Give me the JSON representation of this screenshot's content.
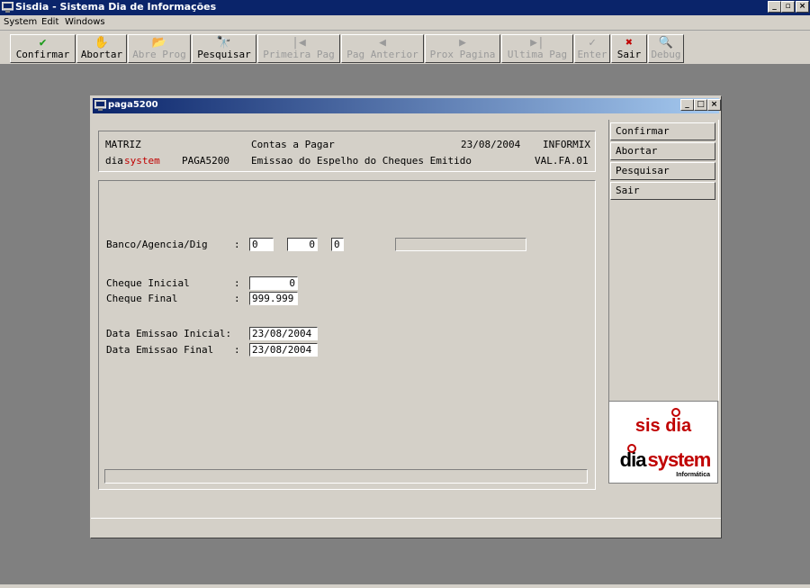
{
  "window": {
    "title": "Sisdia - Sistema Dia de Informações",
    "min": "_",
    "max": "▫",
    "close": "×"
  },
  "menu": [
    "System",
    "Edit",
    "Windows"
  ],
  "toolbar": [
    {
      "label": "Confirmar",
      "icon": "✔",
      "icon_name": "checkmark-icon",
      "enabled": true
    },
    {
      "label": "Abortar",
      "icon": "✋",
      "icon_name": "hand-icon",
      "enabled": true
    },
    {
      "label": "Abre Prog",
      "icon": "📂",
      "icon_name": "folder-icon",
      "enabled": false
    },
    {
      "label": "Pesquisar",
      "icon": "🔭",
      "icon_name": "binoculars-icon",
      "enabled": true
    },
    {
      "label": "Primeira Pag",
      "icon": "|◀",
      "icon_name": "first-page-icon",
      "enabled": false
    },
    {
      "label": "Pag Anterior",
      "icon": "◀",
      "icon_name": "prev-page-icon",
      "enabled": false
    },
    {
      "label": "Prox Pagina",
      "icon": "▶",
      "icon_name": "next-page-icon",
      "enabled": false
    },
    {
      "label": "Ultima Pag",
      "icon": "▶|",
      "icon_name": "last-page-icon",
      "enabled": false
    },
    {
      "label": "Enter",
      "icon": "✓",
      "icon_name": "enter-icon",
      "enabled": false
    },
    {
      "label": "Sair",
      "icon": "✖",
      "icon_name": "exit-icon",
      "enabled": true
    },
    {
      "label": "Debug",
      "icon": "🔍",
      "icon_name": "magnifier-icon",
      "enabled": false
    }
  ],
  "child": {
    "title": "paga5200",
    "min": "_",
    "max": "□",
    "close": "×",
    "header": {
      "company": "MATRIZ",
      "module": "Contas a Pagar",
      "date": "23/08/2004",
      "db": "INFORMIX",
      "brand_a": "dia",
      "brand_b": "system",
      "program": "PAGA5200",
      "description": "Emissao do Espelho do Cheques Emitido",
      "version": "VAL.FA.01"
    },
    "form": {
      "banco_label": "Banco/Agencia/Dig",
      "colon": ":",
      "banco": "0",
      "agencia": "0",
      "dig": "0",
      "banco_desc": "",
      "cheque_inicial_label": "Cheque Inicial",
      "cheque_inicial": "0",
      "cheque_final_label": "Cheque Final",
      "cheque_final": "999.999",
      "data_inicial_label": "Data Emissao Inicial:",
      "data_inicial": "23/08/2004",
      "data_final_label": "Data Emissao Final",
      "data_final": "23/08/2004"
    },
    "side_buttons": [
      "Confirmar",
      "Abortar",
      "Pesquisar",
      "Sair"
    ],
    "logo": {
      "top": "sis dia",
      "bottom": "dia system",
      "sub": "Informática"
    }
  },
  "colors": {
    "brand_red": "#c00000",
    "title_blue": "#0a246a"
  }
}
